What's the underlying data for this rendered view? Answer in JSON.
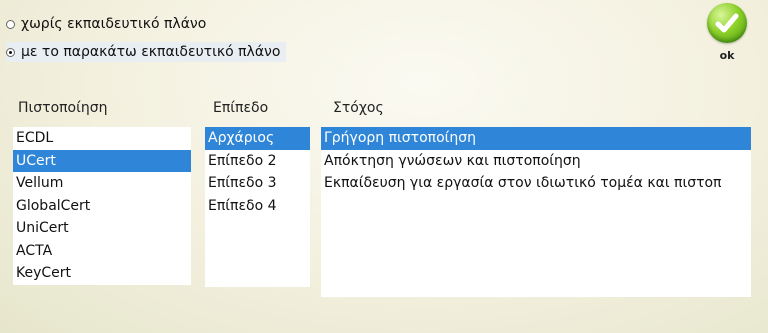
{
  "training_options": [
    {
      "label": "χωρίς εκπαιδευτικό πλάνο",
      "selected": false
    },
    {
      "label": "με το παρακάτω εκπαιδευτικό πλάνο",
      "selected": true
    }
  ],
  "ok_button": {
    "label": "ok",
    "icon": "checkmark-icon"
  },
  "columns": {
    "certification": {
      "header": "Πιστοποίηση",
      "items": [
        "ECDL",
        "UCert",
        "Vellum",
        "GlobalCert",
        "UniCert",
        "ACTA",
        "KeyCert"
      ],
      "selected": "UCert"
    },
    "level": {
      "header": "Επίπεδο",
      "items": [
        "Αρχάριος",
        "Επίπεδο 2",
        "Επίπεδο 3",
        "Επίπεδο 4"
      ],
      "selected": "Αρχάριος"
    },
    "goal": {
      "header": "Στόχος",
      "items": [
        "Γρήγορη πιστοποίηση",
        "Απόκτηση γνώσεων και πιστοποίηση",
        "Εκπαίδευση για εργασία στον ιδιωτικό τομέα και πιστοπ"
      ],
      "selected": "Γρήγορη πιστοποίηση"
    }
  },
  "colors": {
    "selection": "#2f86d8",
    "ok_green": "#6cbf1c"
  }
}
